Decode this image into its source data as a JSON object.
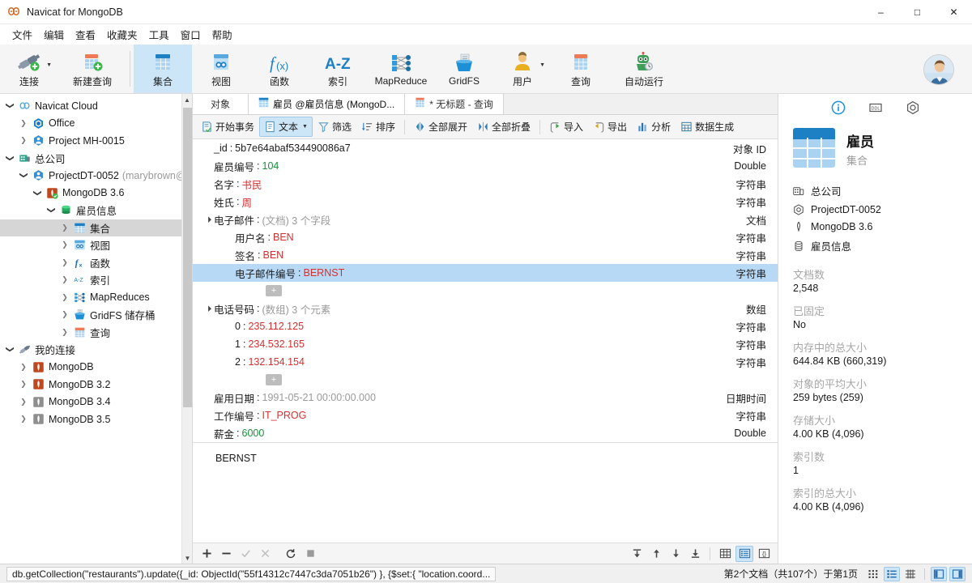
{
  "window": {
    "title": "Navicat for MongoDB",
    "app_icon": "navicat-logo-icon",
    "minimize": "–",
    "maximize": "□",
    "close": "✕"
  },
  "menubar": [
    {
      "label": "文件",
      "name": "menu-file"
    },
    {
      "label": "编辑",
      "name": "menu-edit"
    },
    {
      "label": "查看",
      "name": "menu-view"
    },
    {
      "label": "收藏夹",
      "name": "menu-favorites"
    },
    {
      "label": "工具",
      "name": "menu-tools"
    },
    {
      "label": "窗口",
      "name": "menu-window"
    },
    {
      "label": "帮助",
      "name": "menu-help"
    }
  ],
  "toolbar": {
    "items": [
      {
        "label": "连接",
        "icon": "connection-icon",
        "name": "toolbar-connection",
        "caret": true
      },
      {
        "label": "新建查询",
        "icon": "new-query-icon",
        "name": "toolbar-new-query",
        "caret": false
      },
      {
        "label": "集合",
        "icon": "collection-icon",
        "name": "toolbar-collection",
        "active": true
      },
      {
        "label": "视图",
        "icon": "view-icon",
        "name": "toolbar-view"
      },
      {
        "label": "函数",
        "icon": "function-fx-icon",
        "name": "toolbar-function"
      },
      {
        "label": "索引",
        "icon": "index-az-icon",
        "name": "toolbar-index"
      },
      {
        "label": "MapReduce",
        "icon": "mapreduce-icon",
        "name": "toolbar-mapreduce"
      },
      {
        "label": "GridFS",
        "icon": "gridfs-icon",
        "name": "toolbar-gridfs"
      },
      {
        "label": "用户",
        "icon": "user-icon",
        "name": "toolbar-user",
        "caret": true
      },
      {
        "label": "查询",
        "icon": "query-icon",
        "name": "toolbar-query"
      },
      {
        "label": "自动运行",
        "icon": "automation-robot-icon",
        "name": "toolbar-automation"
      }
    ]
  },
  "sidebar": {
    "nodes": [
      {
        "label": "Navicat Cloud",
        "icon": "cloud-icon",
        "indent": 0,
        "state": "open"
      },
      {
        "label": "Office",
        "icon": "office-project-icon",
        "indent": 1,
        "state": "closed"
      },
      {
        "label": "Project MH-0015",
        "icon": "project-icon",
        "indent": 1,
        "state": "closed"
      },
      {
        "label": "总公司",
        "icon": "company-icon",
        "indent": 0,
        "state": "open"
      },
      {
        "label": "ProjectDT-0052",
        "sublabel": "(marybrown@",
        "icon": "project-icon",
        "indent": 1,
        "state": "open"
      },
      {
        "label": "MongoDB 3.6",
        "icon": "mongodb-connected-icon",
        "indent": 2,
        "state": "open"
      },
      {
        "label": "雇员信息",
        "icon": "database-icon",
        "indent": 3,
        "state": "open"
      },
      {
        "label": "集合",
        "icon": "collection-icon",
        "indent": 4,
        "state": "closed",
        "selected": true
      },
      {
        "label": "视图",
        "icon": "view-icon",
        "indent": 4,
        "state": "closed"
      },
      {
        "label": "函数",
        "icon": "function-fx-icon",
        "indent": 4,
        "state": "closed"
      },
      {
        "label": "索引",
        "icon": "index-az-icon",
        "indent": 4,
        "state": "closed"
      },
      {
        "label": "MapReduces",
        "icon": "mapreduce-icon",
        "indent": 4,
        "state": "closed"
      },
      {
        "label": "GridFS 储存桶",
        "icon": "gridfs-icon",
        "indent": 4,
        "state": "closed"
      },
      {
        "label": "查询",
        "icon": "query-icon",
        "indent": 4,
        "state": "closed"
      },
      {
        "label": "我的连接",
        "icon": "my-connections-icon",
        "indent": 0,
        "state": "open"
      },
      {
        "label": "MongoDB",
        "icon": "mongodb-icon",
        "indent": 1,
        "state": "closed"
      },
      {
        "label": "MongoDB 3.2",
        "icon": "mongodb-icon",
        "indent": 1,
        "state": "closed"
      },
      {
        "label": "MongoDB 3.4",
        "icon": "mongodb-gray-icon",
        "indent": 1,
        "state": "closed"
      },
      {
        "label": "MongoDB 3.5",
        "icon": "mongodb-gray-icon",
        "indent": 1,
        "state": "closed"
      }
    ]
  },
  "tabs": [
    {
      "label": "对象",
      "name": "tab-objects",
      "icon": null,
      "active": false
    },
    {
      "label": "雇员 @雇员信息 (MongoD...",
      "name": "tab-collection-employee",
      "icon": "collection-icon",
      "active": true
    },
    {
      "label": "* 无标题 - 查询",
      "name": "tab-untitled-query",
      "icon": "query-icon",
      "active": false
    }
  ],
  "subtoolbar": [
    {
      "label": "开始事务",
      "icon": "transaction-icon",
      "name": "begin-transaction-button"
    },
    {
      "label": "文本",
      "icon": "text-document-icon",
      "name": "text-view-button",
      "selected": true,
      "caret": true
    },
    {
      "label": "筛选",
      "icon": "filter-funnel-icon",
      "name": "filter-button"
    },
    {
      "label": "排序",
      "icon": "sort-icon",
      "name": "sort-button"
    },
    {
      "sep": true
    },
    {
      "label": "全部展开",
      "icon": "expand-all-icon",
      "name": "expand-all-button"
    },
    {
      "label": "全部折叠",
      "icon": "collapse-all-icon",
      "name": "collapse-all-button"
    },
    {
      "sep": true
    },
    {
      "label": "导入",
      "icon": "import-icon",
      "name": "import-button"
    },
    {
      "label": "导出",
      "icon": "export-icon",
      "name": "export-button"
    },
    {
      "label": "分析",
      "icon": "analyze-chart-icon",
      "name": "analyze-button"
    },
    {
      "label": "数据生成",
      "icon": "data-generation-icon",
      "name": "data-generation-button"
    }
  ],
  "document": {
    "rows": [
      {
        "indent": 0,
        "expander": null,
        "key": "_id",
        "value": "5b7e64abaf534490086a7",
        "value_style": "plain",
        "type": "对象 ID"
      },
      {
        "indent": 0,
        "expander": null,
        "key": "雇员编号",
        "value": "104",
        "value_style": "num",
        "type": "Double"
      },
      {
        "indent": 0,
        "expander": null,
        "key": "名字",
        "value": "书民",
        "value_style": "str",
        "type": "字符串"
      },
      {
        "indent": 0,
        "expander": null,
        "key": "姓氏",
        "value": "周",
        "value_style": "str",
        "type": "字符串"
      },
      {
        "indent": 0,
        "expander": "open",
        "key": "电子邮件",
        "meta": "(文档) 3 个字段",
        "value": "",
        "value_style": "meta",
        "type": "文档"
      },
      {
        "indent": 1,
        "expander": null,
        "key": "用户名",
        "value": "BEN",
        "value_style": "str",
        "type": "字符串"
      },
      {
        "indent": 1,
        "expander": null,
        "key": "签名",
        "value": "BEN",
        "value_style": "str",
        "type": "字符串"
      },
      {
        "indent": 1,
        "expander": null,
        "key": "电子邮件编号",
        "value": "BERNST",
        "value_style": "str",
        "type": "字符串",
        "selected": true
      },
      {
        "indent": 1,
        "plus": true
      },
      {
        "indent": 0,
        "expander": "open",
        "key": "电话号码",
        "meta": "(数组) 3 个元素",
        "value": "",
        "value_style": "meta",
        "type": "数组"
      },
      {
        "indent": 1,
        "expander": null,
        "key": "0",
        "value": "235.112.125",
        "value_style": "str",
        "type": "字符串"
      },
      {
        "indent": 1,
        "expander": null,
        "key": "1",
        "value": "234.532.165",
        "value_style": "str",
        "type": "字符串"
      },
      {
        "indent": 1,
        "expander": null,
        "key": "2",
        "value": "132.154.154",
        "value_style": "str",
        "type": "字符串"
      },
      {
        "indent": 1,
        "plus": true
      },
      {
        "indent": 0,
        "expander": null,
        "key": "雇用日期",
        "value": "1991-05-21 00:00:00.000",
        "value_style": "dim",
        "type": "日期时间"
      },
      {
        "indent": 0,
        "expander": null,
        "key": "工作编号",
        "value": "IT_PROG",
        "value_style": "str",
        "type": "字符串"
      },
      {
        "indent": 0,
        "expander": null,
        "key": "薪金",
        "value": "6000",
        "value_style": "num",
        "type": "Double"
      }
    ],
    "value_editor": "BERNST",
    "plus_label": "+"
  },
  "bottombar": {
    "left": [
      {
        "glyph": "+",
        "name": "add-record-button",
        "disabled": false
      },
      {
        "glyph": "−",
        "name": "remove-record-button",
        "disabled": false
      },
      {
        "glyph": "✓",
        "name": "apply-change-button",
        "disabled": true
      },
      {
        "glyph": "✕",
        "name": "discard-change-button",
        "disabled": true
      },
      {
        "glyph": "⟳",
        "name": "refresh-button",
        "disabled": false
      },
      {
        "glyph": "■",
        "name": "stop-button",
        "disabled": true
      }
    ],
    "nav": [
      {
        "glyph": "first",
        "name": "first-record-button"
      },
      {
        "glyph": "prev",
        "name": "previous-record-button"
      },
      {
        "glyph": "next",
        "name": "next-record-button"
      },
      {
        "glyph": "last",
        "name": "last-record-button"
      }
    ],
    "views": [
      {
        "glyph": "grid",
        "name": "grid-view-button",
        "selected": false
      },
      {
        "glyph": "tree",
        "name": "tree-view-button",
        "selected": true
      },
      {
        "glyph": "json",
        "name": "json-view-button",
        "selected": false
      }
    ]
  },
  "info": {
    "tabs": [
      {
        "icon": "info-circle-icon",
        "name": "info-tab-general",
        "active": true
      },
      {
        "icon": "ddl-icon",
        "name": "info-tab-ddl",
        "active": false
      },
      {
        "icon": "hex-gear-icon",
        "name": "info-tab-settings",
        "active": false
      }
    ],
    "title": "雇员",
    "subtitle": "集合",
    "icon": "collection-big-icon",
    "breadcrumbs": [
      {
        "label": "总公司",
        "icon": "company-icon"
      },
      {
        "label": "ProjectDT-0052",
        "icon": "hex-project-icon"
      },
      {
        "label": "MongoDB 3.6",
        "icon": "mongodb-leaf-icon"
      },
      {
        "label": "雇员信息",
        "icon": "database-icon"
      }
    ],
    "stats": [
      {
        "label": "文档数",
        "value": "2,548"
      },
      {
        "label": "已固定",
        "value": "No"
      },
      {
        "label": "内存中的总大小",
        "value": "644.84 KB (660,319)"
      },
      {
        "label": "对象的平均大小",
        "value": "259 bytes (259)"
      },
      {
        "label": "存储大小",
        "value": "4.00 KB (4,096)"
      },
      {
        "label": "索引数",
        "value": "1"
      },
      {
        "label": "索引的总大小",
        "value": "4.00 KB (4,096)"
      }
    ]
  },
  "statusbar": {
    "query": "db.getCollection(\"restaurants\").update({_id: ObjectId(\"55f14312c7447c3da7051b26\") }, {$set:{ \"location.coord...",
    "record_info": "第2个文档（共107个）于第1页",
    "buttons": [
      {
        "glyph": "dots-grid",
        "name": "status-grid-view-button",
        "selected": false
      },
      {
        "glyph": "list",
        "name": "status-form-view-button",
        "selected": true
      },
      {
        "glyph": "table",
        "name": "status-table-view-button",
        "selected": false
      },
      {
        "glyph": "left-panel",
        "name": "toggle-left-panel-button",
        "selected": true
      },
      {
        "glyph": "right-panel",
        "name": "toggle-right-panel-button",
        "selected": true
      }
    ]
  },
  "colors": {
    "accent": "#0a84d8",
    "selection": "#b8d9f5",
    "toolbar_active": "#cde6f7",
    "string_value": "#d62f2f",
    "number_value": "#1a8f3c",
    "muted": "#9a9a9a"
  }
}
